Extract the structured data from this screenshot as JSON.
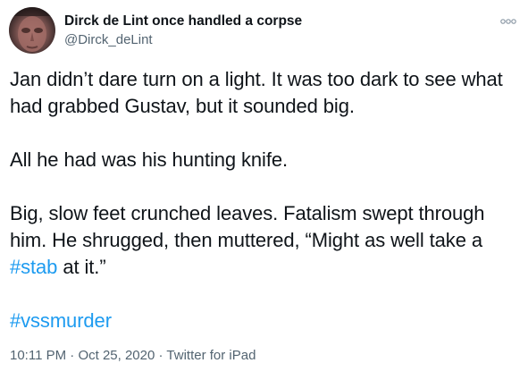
{
  "author": {
    "display_name": "Dirck de Lint once handled a corpse",
    "handle": "@Dirck_deLint",
    "avatar_icon": "avatar-photo"
  },
  "more_icon": "more-options-icon",
  "tweet": {
    "line1_a": "Jan didn’t dare turn on a light. It was too dark to see what",
    "line1_b": "had grabbed Gustav, but it sounded big.",
    "line2": "All he had was his hunting knife.",
    "line3_a": "Big, slow feet crunched leaves. Fatalism swept through",
    "line3_b": "him. He shrugged, then muttered, “Might as well take a",
    "hashtag_stab": "#stab",
    "line3_tail": " at it.”",
    "hashtag_vss": "#vssmurder"
  },
  "meta": {
    "time": "10:11 PM",
    "sep1": " · ",
    "date": "Oct 25, 2020",
    "sep2": " · ",
    "source": "Twitter for iPad"
  },
  "colors": {
    "link": "#1d9bf0",
    "text": "#0f1419",
    "secondary": "#536471"
  }
}
